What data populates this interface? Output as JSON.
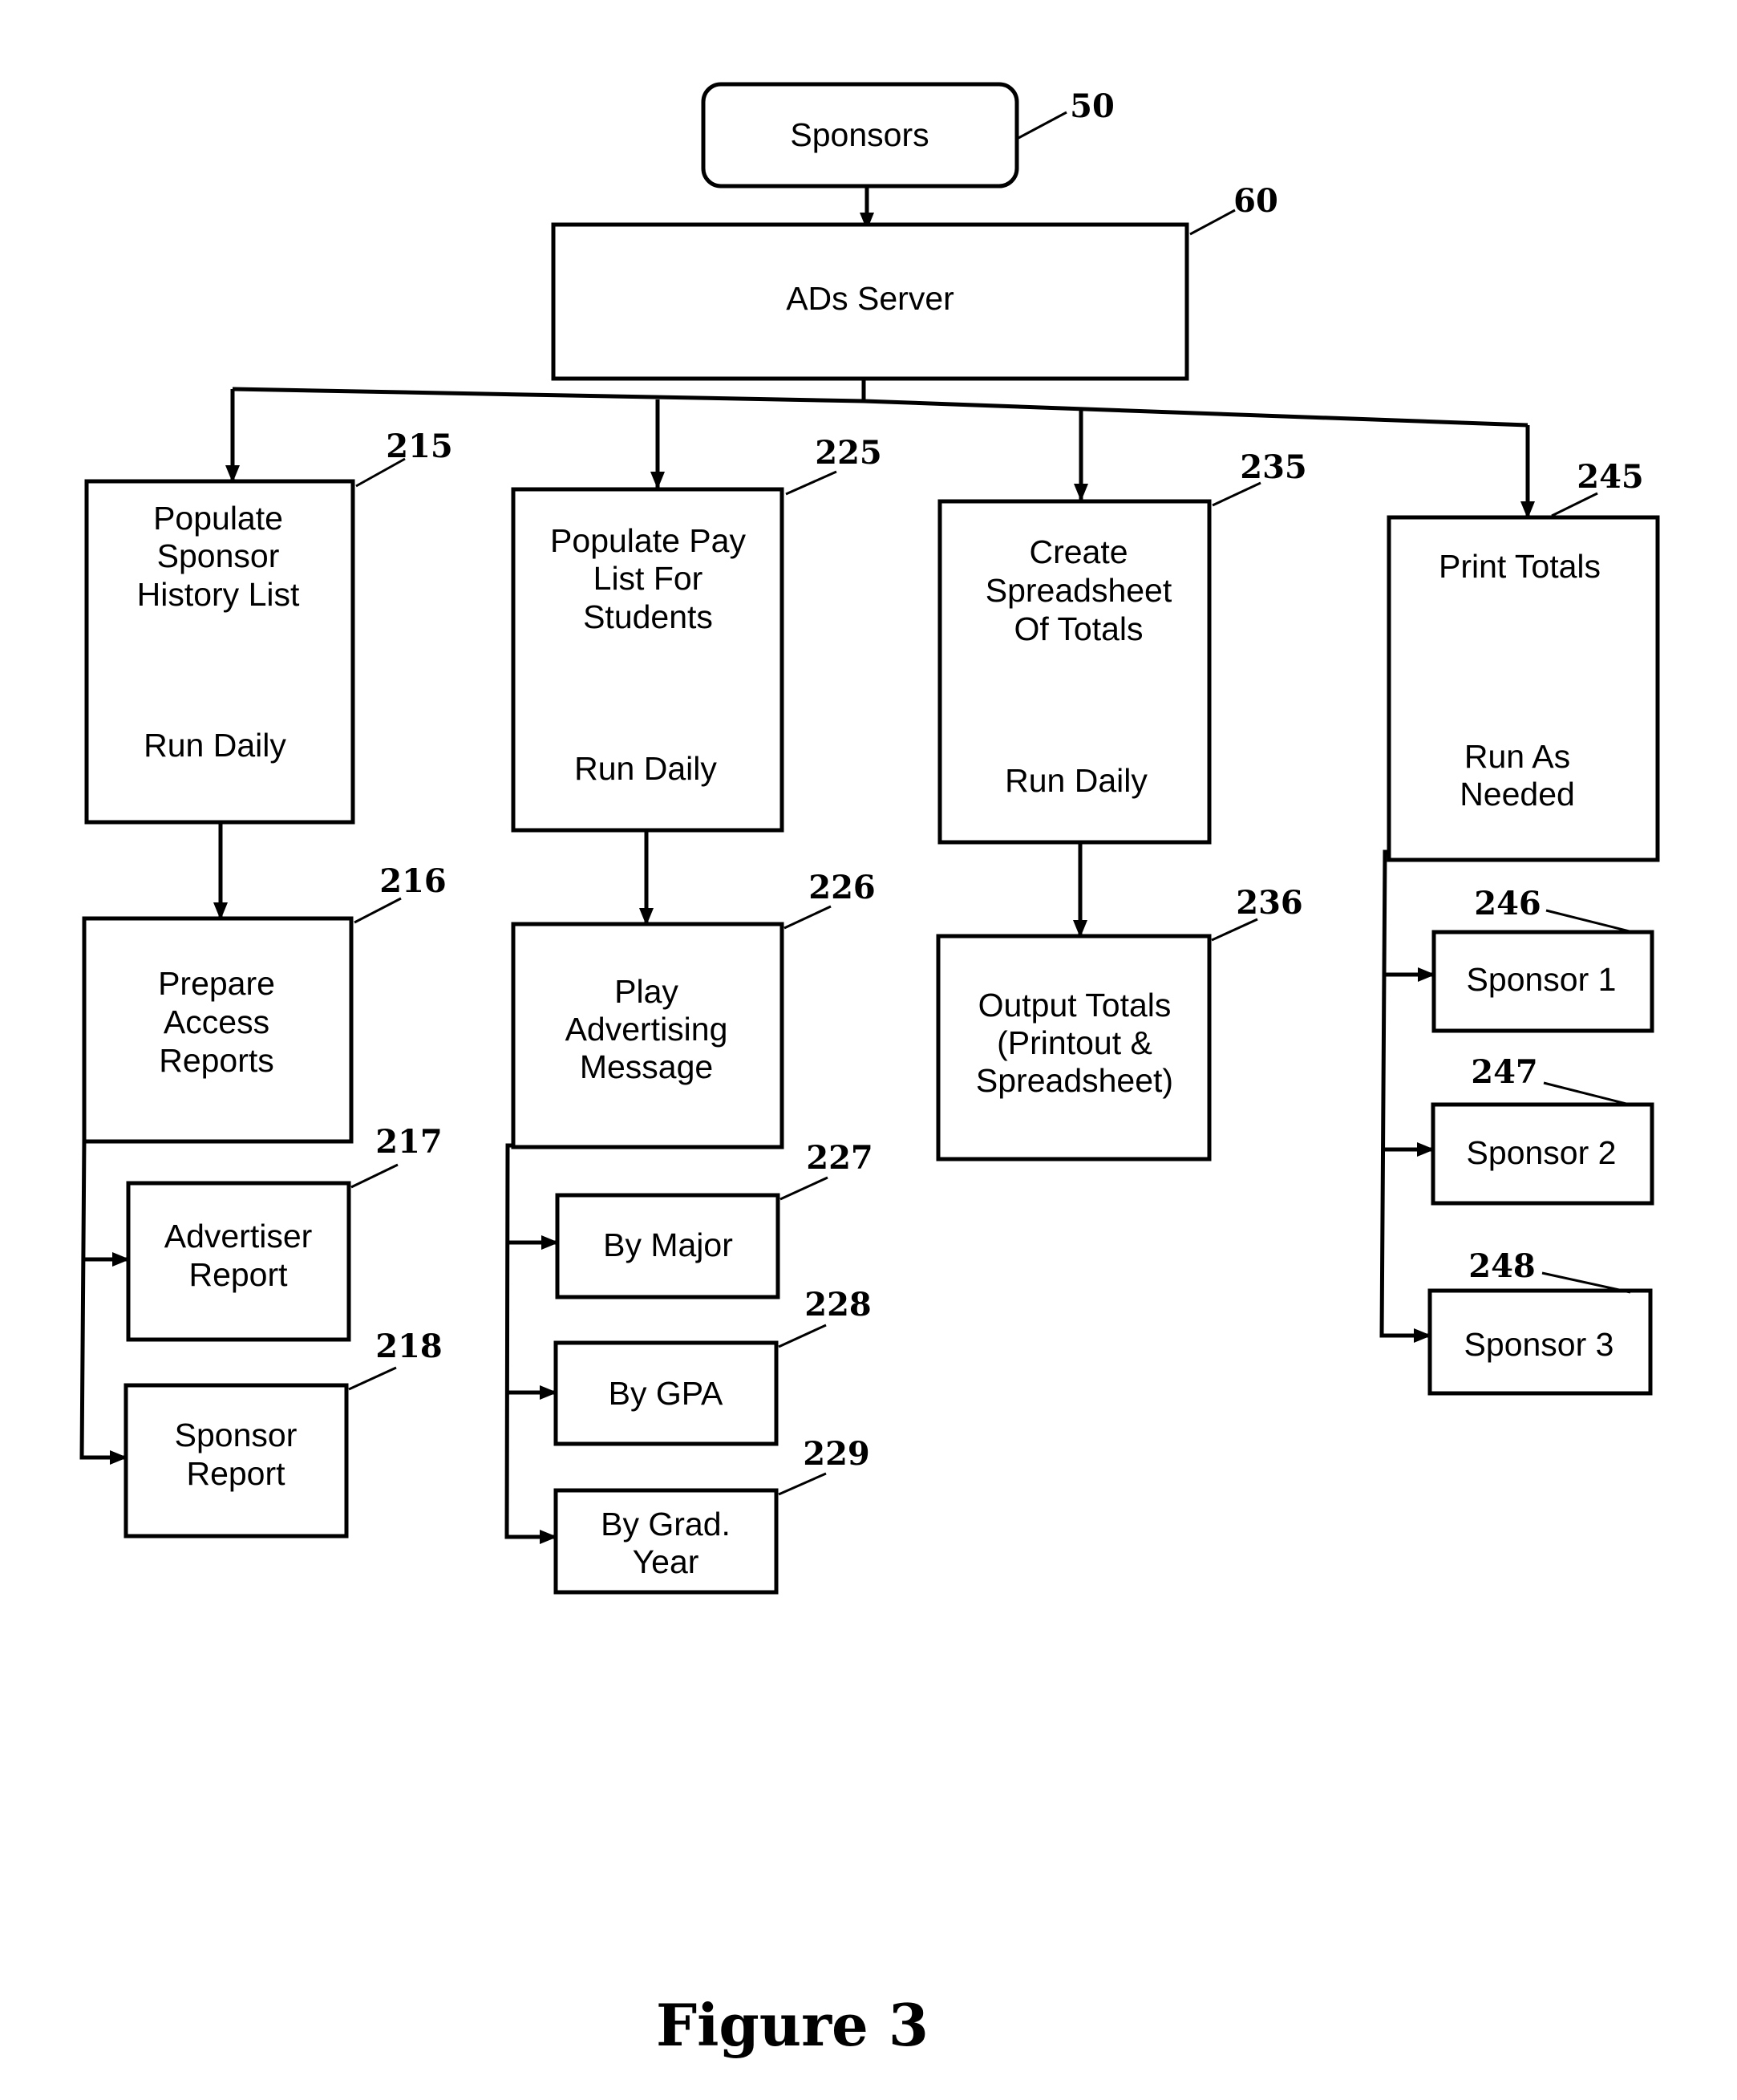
{
  "figure": {
    "caption": "Figure 3",
    "root": {
      "ref": "50",
      "lines": [
        "Sponsors"
      ]
    },
    "server": {
      "ref": "60",
      "lines": [
        "ADs Server"
      ]
    },
    "columns": [
      {
        "main": {
          "ref": "215",
          "lines": [
            "Populate",
            "Sponsor",
            "History List"
          ],
          "schedule": [
            "Run Daily"
          ]
        },
        "next": {
          "ref": "216",
          "lines": [
            "Prepare",
            "Access",
            "Reports"
          ]
        },
        "children": [
          {
            "ref": "217",
            "lines": [
              "Advertiser",
              "Report"
            ]
          },
          {
            "ref": "218",
            "lines": [
              "Sponsor",
              "Report"
            ]
          }
        ]
      },
      {
        "main": {
          "ref": "225",
          "lines": [
            "Populate Pay",
            "List For",
            "Students"
          ],
          "schedule": [
            "Run Daily"
          ]
        },
        "next": {
          "ref": "226",
          "lines": [
            "Play",
            "Advertising",
            "Message"
          ]
        },
        "children": [
          {
            "ref": "227",
            "lines": [
              "By Major"
            ]
          },
          {
            "ref": "228",
            "lines": [
              "By GPA"
            ]
          },
          {
            "ref": "229",
            "lines": [
              "By Grad.",
              "Year"
            ]
          }
        ]
      },
      {
        "main": {
          "ref": "235",
          "lines": [
            "Create",
            "Spreadsheet",
            "Of Totals"
          ],
          "schedule": [
            "Run Daily"
          ]
        },
        "next": {
          "ref": "236",
          "lines": [
            "Output Totals",
            "(Printout &",
            "Spreadsheet)"
          ]
        },
        "children": []
      },
      {
        "main": {
          "ref": "245",
          "lines": [
            "Print Totals"
          ],
          "schedule": [
            "Run As",
            "Needed"
          ]
        },
        "children": [
          {
            "ref": "246",
            "lines": [
              "Sponsor 1"
            ]
          },
          {
            "ref": "247",
            "lines": [
              "Sponsor 2"
            ]
          },
          {
            "ref": "248",
            "lines": [
              "Sponsor 3"
            ]
          }
        ]
      }
    ]
  }
}
